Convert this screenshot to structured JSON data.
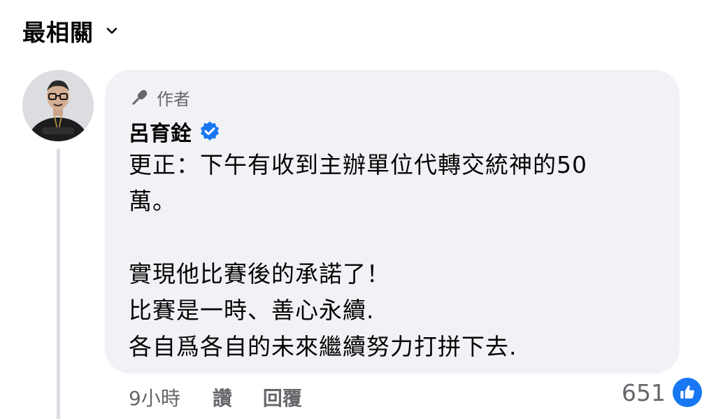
{
  "sort": {
    "label": "最相關"
  },
  "comment": {
    "badge_label": "作者",
    "author_name": "呂育銓",
    "verified": true,
    "body_lines": [
      "更正：下午有收到主辦單位代轉交統神的50",
      "萬。",
      "",
      "實現他比賽後的承諾了！",
      "比賽是一時、善心永續.",
      "各自爲各自的未來繼續努力打拼下去."
    ],
    "timestamp": "9小時",
    "like_label": "讚",
    "reply_label": "回覆",
    "reaction_count": "651"
  },
  "colors": {
    "accent": "#1877f2",
    "bubble_bg": "#f0f2f5",
    "secondary_text": "#65676b"
  },
  "icons": {
    "sort": "chevron-down-icon",
    "badge": "microphone-icon",
    "verified": "verified-badge-icon",
    "reaction": "thumbs-up-icon"
  }
}
